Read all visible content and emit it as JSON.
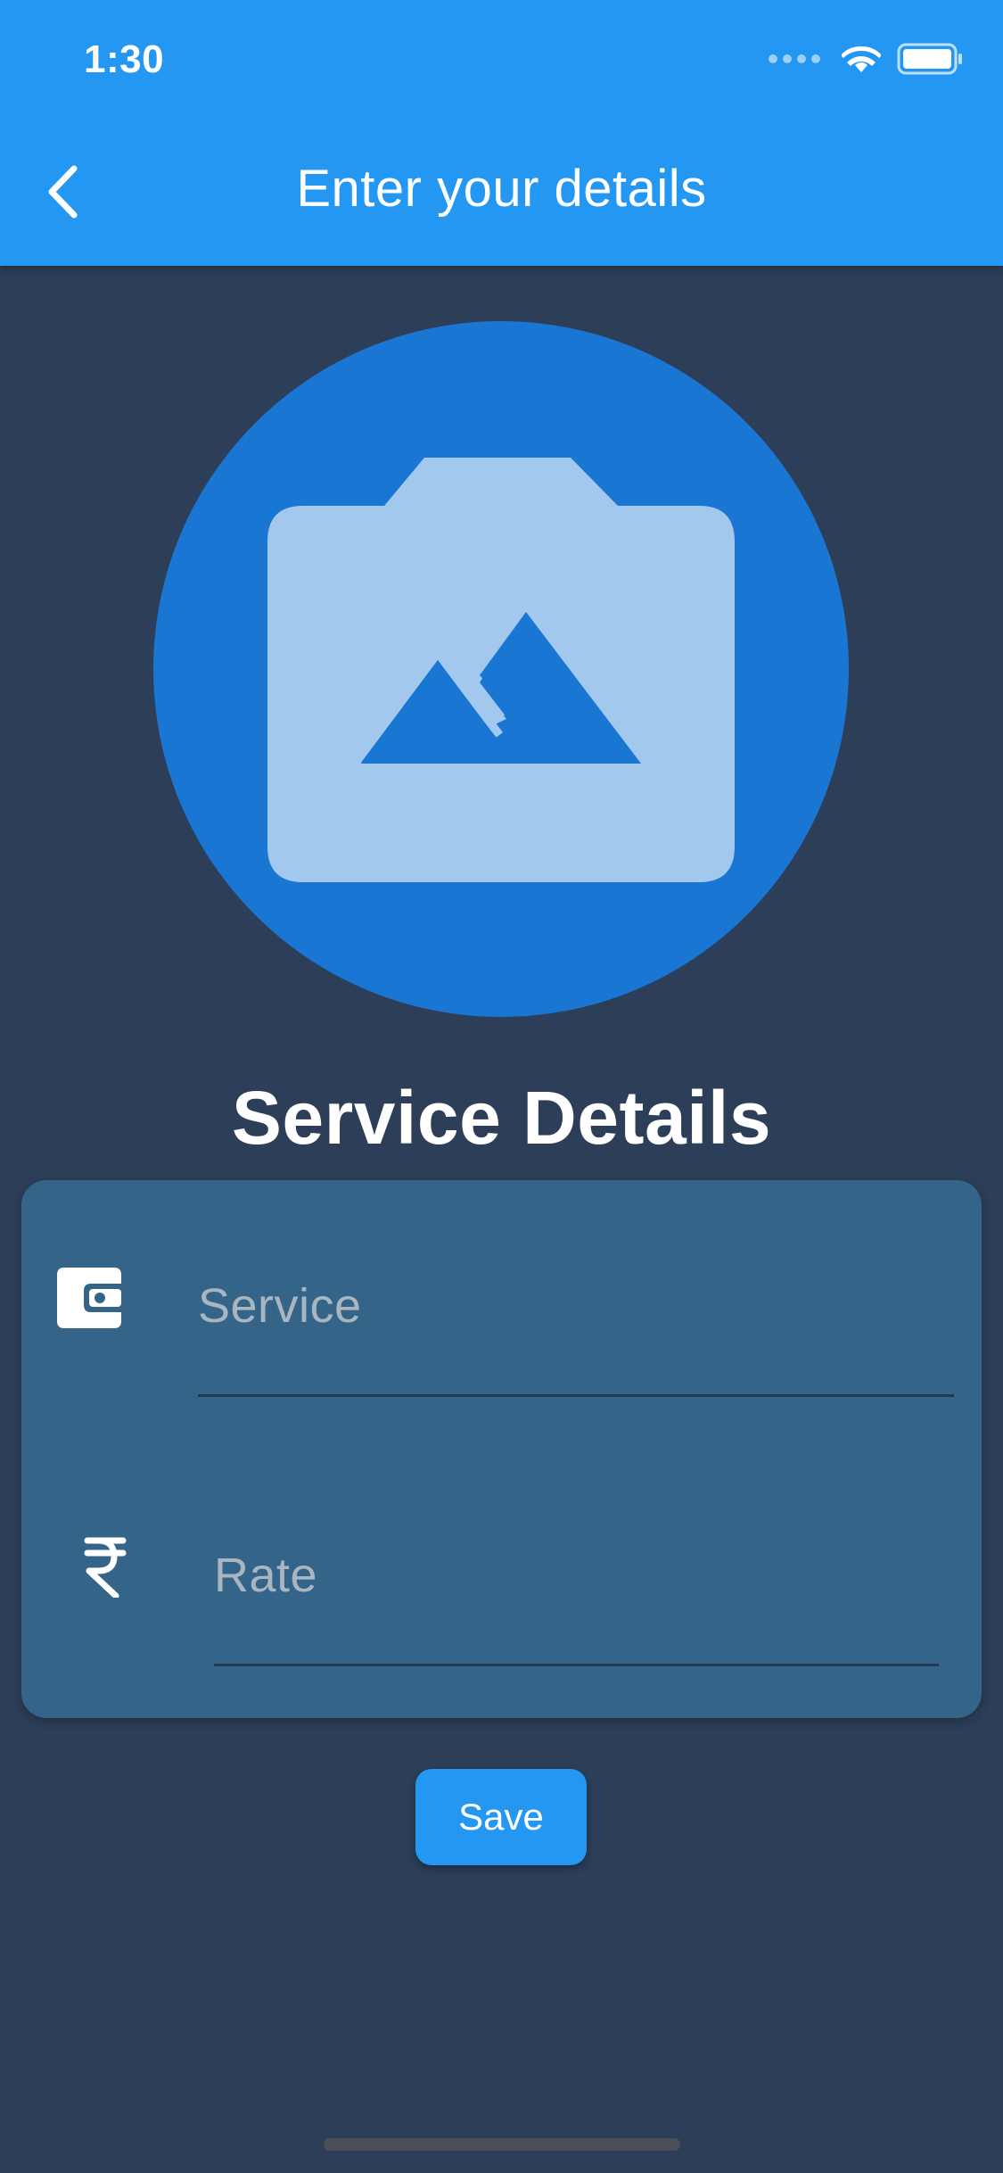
{
  "status_bar": {
    "time": "1:30",
    "icons": [
      "signal-icon",
      "wifi-icon",
      "battery-icon"
    ]
  },
  "app_bar": {
    "title": "Enter your details",
    "back_icon": "chevron-left-icon",
    "background": "#2397f1"
  },
  "avatar": {
    "icon": "camera-image-icon",
    "circle_color": "#1a76d3",
    "icon_color": "#a3c8ed"
  },
  "section": {
    "title": "Service Details"
  },
  "form": {
    "fields": [
      {
        "icon": "wallet-icon",
        "placeholder": "Service",
        "value": ""
      },
      {
        "icon": "rupee-icon",
        "placeholder": "Rate",
        "value": ""
      }
    ],
    "card_color": "#346589"
  },
  "actions": {
    "save_label": "Save"
  },
  "colors": {
    "background": "#2c3e58",
    "accent": "#2397f1"
  }
}
